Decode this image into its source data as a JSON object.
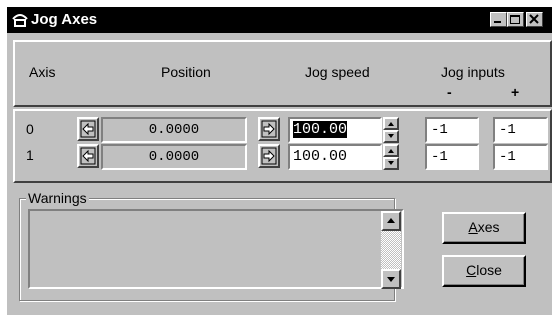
{
  "window": {
    "title": "Jog Axes",
    "icon": "jog-axes-app-icon",
    "controls": [
      "minimize-icon",
      "maximize-icon",
      "close-icon"
    ]
  },
  "header": {
    "axis": "Axis",
    "position": "Position",
    "jog_speed": "Jog speed",
    "jog_inputs": "Jog inputs",
    "minus": "-",
    "plus": "+"
  },
  "rows": [
    {
      "axis": "0",
      "position": "0.0000",
      "jog_speed": "100.00",
      "jog_minus": "-1",
      "jog_plus": "-1",
      "speed_selected": true
    },
    {
      "axis": "1",
      "position": "0.0000",
      "jog_speed": "100.00",
      "jog_minus": "-1",
      "jog_plus": "-1",
      "speed_selected": false
    }
  ],
  "warnings": {
    "label": "Warnings",
    "text": ""
  },
  "buttons": {
    "axes_mnemonic": "A",
    "axes_rest": "xes",
    "close_mnemonic": "C",
    "close_rest": "lose"
  },
  "icons": {
    "jog_negative": "jog-negative-icon",
    "jog_positive": "jog-positive-icon",
    "spin_up": "spin-up-icon",
    "spin_down": "spin-down-icon",
    "scroll_up": "scroll-up-icon",
    "scroll_down": "scroll-down-icon"
  },
  "colors": {
    "face": "#c0c0c0",
    "titlebar": "#000000",
    "selection": "#000000"
  }
}
